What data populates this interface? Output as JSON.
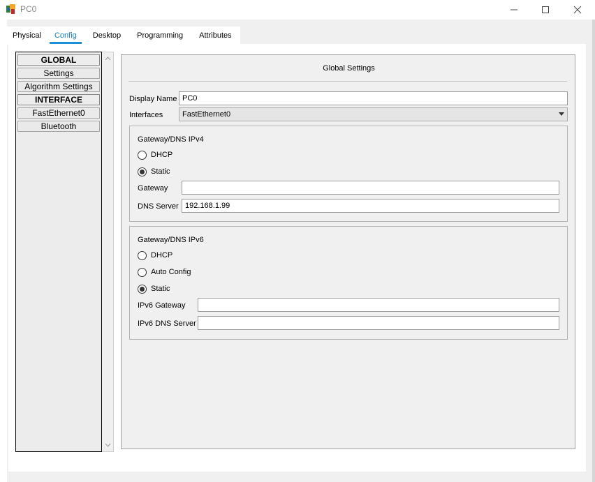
{
  "window": {
    "title": "PC0",
    "controls": {
      "minimize": "—",
      "maximize": "☐",
      "close": "✕"
    }
  },
  "tabs": [
    {
      "label": "Physical",
      "active": false
    },
    {
      "label": "Config",
      "active": true
    },
    {
      "label": "Desktop",
      "active": false
    },
    {
      "label": "Programming",
      "active": false
    },
    {
      "label": "Attributes",
      "active": false
    }
  ],
  "sidebar": {
    "items": [
      {
        "label": "GLOBAL",
        "header": true
      },
      {
        "label": "Settings",
        "header": false
      },
      {
        "label": "Algorithm Settings",
        "header": false
      },
      {
        "label": "INTERFACE",
        "header": true
      },
      {
        "label": "FastEthernet0",
        "header": false
      },
      {
        "label": "Bluetooth",
        "header": false
      }
    ]
  },
  "main": {
    "title": "Global Settings",
    "display_name_label": "Display Name",
    "display_name_value": "PC0",
    "interfaces_label": "Interfaces",
    "interfaces_value": "FastEthernet0",
    "ipv4": {
      "title": "Gateway/DNS IPv4",
      "dhcp_label": "DHCP",
      "static_label": "Static",
      "selected": "Static",
      "gateway_label": "Gateway",
      "gateway_value": "",
      "dns_label": "DNS Server",
      "dns_value": "192.168.1.99"
    },
    "ipv6": {
      "title": "Gateway/DNS IPv6",
      "dhcp_label": "DHCP",
      "auto_label": "Auto Config",
      "static_label": "Static",
      "selected": "Static",
      "gateway_label": "IPv6 Gateway",
      "gateway_value": "",
      "dns_label": "IPv6 DNS Server",
      "dns_value": ""
    }
  },
  "colors": {
    "accent": "#1a8fd6",
    "panel_bg": "#f0f0f0"
  }
}
